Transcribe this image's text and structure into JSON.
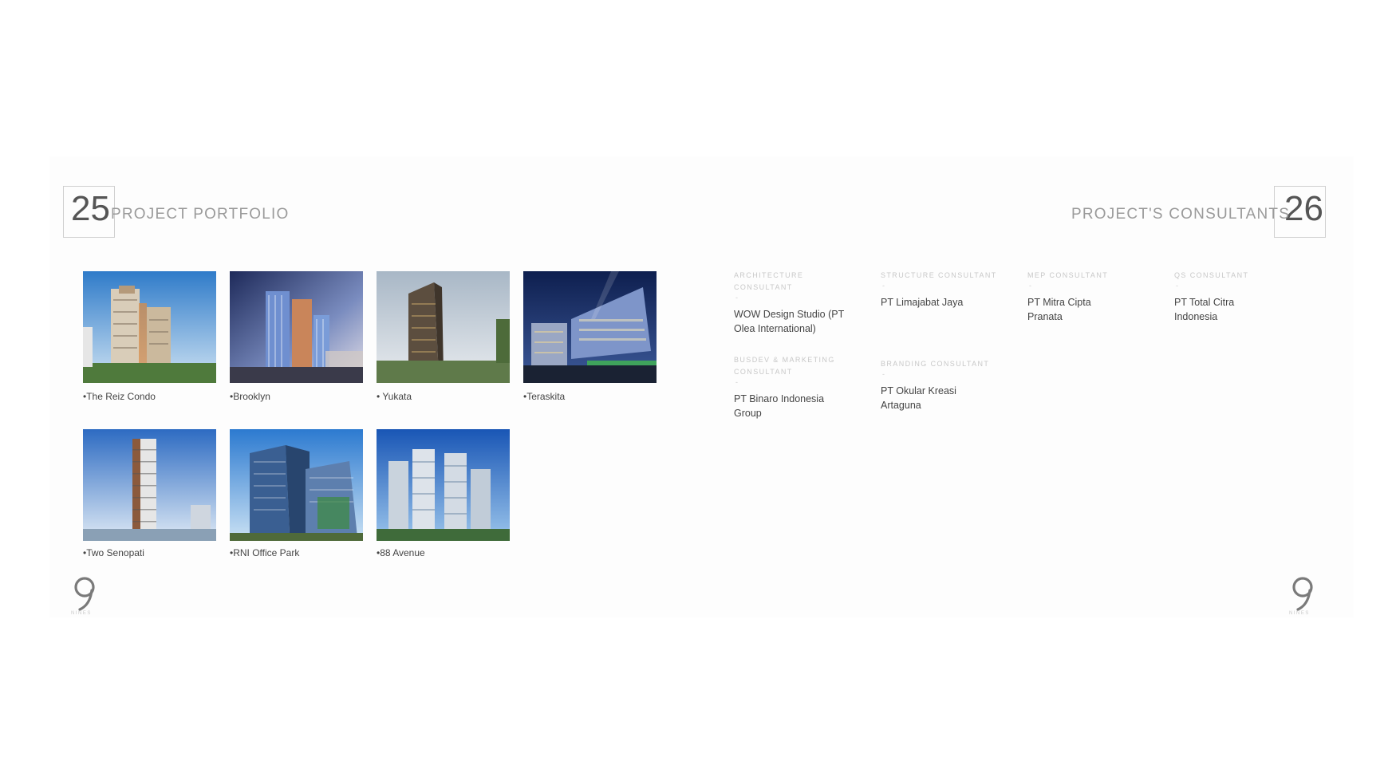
{
  "left_page": {
    "page_number": "25",
    "title": "PROJECT PORTFOLIO",
    "projects": [
      {
        "caption": "•The Reiz Condo"
      },
      {
        "caption": "•Brooklyn"
      },
      {
        "caption": "•  Yukata"
      },
      {
        "caption": "•Teraskita"
      },
      {
        "caption": "•Two Senopati"
      },
      {
        "caption": "•RNI Office Park"
      },
      {
        "caption": "•88 Avenue"
      }
    ]
  },
  "right_page": {
    "page_number": "26",
    "title": "PROJECT'S CONSULTANTS",
    "consultants": [
      {
        "heading": "ARCHITECTURE CONSULTANT",
        "dash": "-",
        "name": "WOW Design Studio (PT Olea International)"
      },
      {
        "heading": "STRUCTURE CONSULTANT",
        "dash": "-",
        "name": "PT Limajabat Jaya"
      },
      {
        "heading": "MEP CONSULTANT",
        "dash": "-",
        "name": "PT Mitra Cipta Pranata"
      },
      {
        "heading": "QS CONSULTANT",
        "dash": "-",
        "name": "PT Total Citra Indonesia"
      },
      {
        "heading": "BUSDEV & MARKETING CONSULTANT",
        "dash": "-",
        "name": "PT Binaro Indonesia Group"
      },
      {
        "heading": "BRANDING CONSULTANT",
        "dash": "-",
        "name": "PT Okular Kreasi Artaguna"
      }
    ]
  },
  "logo": {
    "sub_text": "NINES"
  },
  "colors": {
    "frame": "#cfcfcf",
    "title": "#9a9a9a",
    "text": "#444444"
  }
}
